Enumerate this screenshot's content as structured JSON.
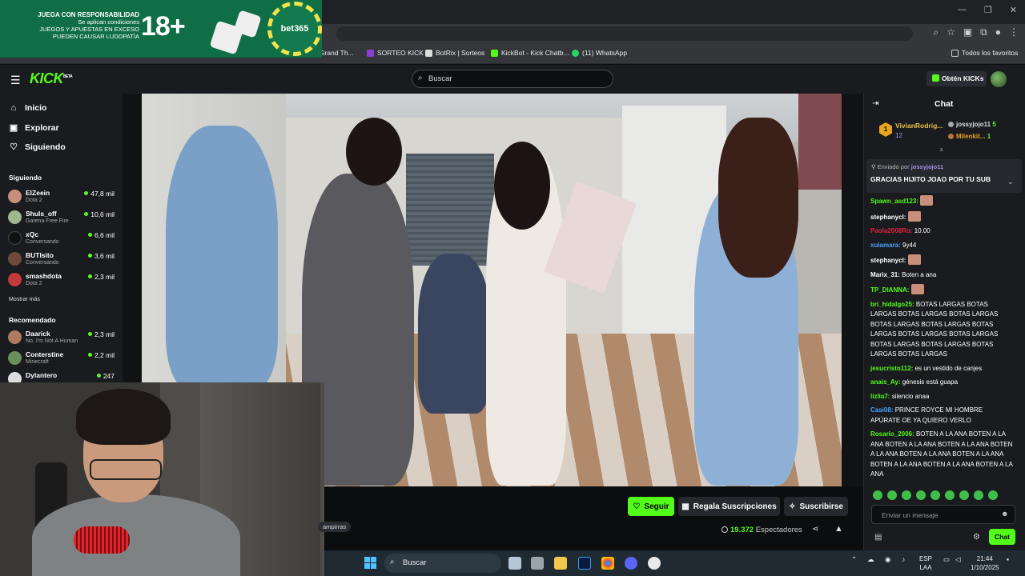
{
  "browser": {
    "bookmarks": [
      {
        "label": "le de Grand Th...",
        "color": "#888888"
      },
      {
        "label": "SORTEO KICK",
        "color": "#8b3fd6"
      },
      {
        "label": "BotRix | Sorteos",
        "color": "#dddddd"
      },
      {
        "label": "KickBot - Kick Chatb...",
        "color": "#53fc18"
      },
      {
        "label": "(11) WhatsApp",
        "color": "#25d366"
      }
    ],
    "all_favorites": "Todos los favoritos"
  },
  "ad": {
    "title": "JUEGA CON RESPONSABILIDAD",
    "line1": "Se aplican condiciones",
    "line2": "JUEGOS Y APUESTAS EN EXCESO",
    "line3": "PUEDEN CAUSAR LUDOPATÍA",
    "age": "18+",
    "brand": "bet365"
  },
  "header": {
    "logo": "KICK",
    "logo_tag": "BETA",
    "search_placeholder": "Buscar",
    "kicks_button": "Obtén KICKs"
  },
  "sidebar": {
    "nav": [
      {
        "label": "Inicio",
        "icon": "home-icon"
      },
      {
        "label": "Explorar",
        "icon": "compass-icon"
      },
      {
        "label": "Siguiendo",
        "icon": "heart-icon"
      }
    ],
    "following_title": "Siguiendo",
    "following": [
      {
        "name": "ElZeein",
        "category": "Dota 2",
        "viewers": "47,8 mil",
        "color": "#c98f7a"
      },
      {
        "name": "Shuls_off",
        "category": "Garena Free Fire",
        "viewers": "10,6 mil",
        "color": "#9fb78d"
      },
      {
        "name": "xQc",
        "category": "Conversando",
        "viewers": "6,6 mil",
        "color": "#111111"
      },
      {
        "name": "BUTIsito",
        "category": "Conversando",
        "viewers": "3,6 mil",
        "color": "#6d4a3a"
      },
      {
        "name": "smashdota",
        "category": "Dota 2",
        "viewers": "2,3 mil",
        "color": "#c43a3a"
      }
    ],
    "show_more": "Mostrar más",
    "recommended_title": "Recomendado",
    "recommended": [
      {
        "name": "Daarick",
        "category": "No, I'm Not A Human",
        "viewers": "2,3 mil",
        "color": "#b07a60"
      },
      {
        "name": "Conterstine",
        "category": "Minecraft",
        "viewers": "2,2 mil",
        "color": "#6a8f5a"
      },
      {
        "name": "Dylantero",
        "category": "",
        "viewers": "247",
        "color": "#dddddd"
      }
    ]
  },
  "stream": {
    "follow": "Seguir",
    "gift_subs": "Regala Suscripciones",
    "subscribe": "Suscribirse",
    "tag": "ampirras",
    "viewers_count": "19.372",
    "viewers_label": "Espectadores"
  },
  "chat": {
    "title": "Chat",
    "leaderboard": {
      "rank1_badge": "1",
      "rank1_name": "VivianRodrig...",
      "rank1_subs": "12",
      "rank2_name": "jossyjojo11",
      "rank2_subs": "5",
      "rank3_name": "Milenkit...",
      "rank3_subs": "1"
    },
    "pinned_by_label": "Enviado por",
    "pinned_by_user": "jossyjojo11",
    "pinned_message": "GRACIAS HIJITO JOAO POR TU SUB",
    "messages": [
      {
        "user": "Spawn_asd123:",
        "color": "#53fc18",
        "text": "",
        "emote": true
      },
      {
        "user": "stephanycl:",
        "color": "#ffffff",
        "text": "",
        "emote": true
      },
      {
        "user": "Paola2008Ro:",
        "color": "#e0243a",
        "text": "10.00",
        "emote": false
      },
      {
        "user": "xuiamara:",
        "color": "#4aa3ff",
        "text": "9y44",
        "emote": false
      },
      {
        "user": "stephanycl:",
        "color": "#ffffff",
        "text": "",
        "emote": true
      },
      {
        "user": "Marix_31:",
        "color": "#ffffff",
        "text": "Boten a ana",
        "emote": false
      },
      {
        "user": "TP_DIANNA:",
        "color": "#53fc18",
        "text": "",
        "emote": true
      },
      {
        "user": "bri_hidalgo25:",
        "color": "#53fc18",
        "text": "BOTAS LARGAS BOTAS LARGAS BOTAS LARGAS BOTAS LARGAS BOTAS LARGAS BOTAS LARGAS BOTAS LARGAS BOTAS LARGAS BOTAS LARGAS BOTAS LARGAS BOTAS LARGAS BOTAS LARGAS BOTAS LARGAS",
        "emote": false
      },
      {
        "user": "jesucristo112:",
        "color": "#53fc18",
        "text": "es un vestido de canjes",
        "emote": false
      },
      {
        "user": "anais_Ay:",
        "color": "#53fc18",
        "text": "génesis está guapa",
        "emote": false
      },
      {
        "user": "lizlia7:",
        "color": "#53fc18",
        "text": "silencio anaa",
        "emote": false
      },
      {
        "user": "Casi08:",
        "color": "#4aa3ff",
        "text": "PRINCE ROYCE MI HOMBRE APÚRATE OE YA QUIERO VERLO",
        "emote": false
      },
      {
        "user": "Rosario_2006:",
        "color": "#53fc18",
        "text": "BOTEN A LA ANA BOTEN A LA ANA BOTEN A LA ANA BOTEN A LA ANA BOTEN A LA ANA BOTEN A LA ANA BOTEN A LA ANA BOTEN A LA ANA BOTEN A LA ANA BOTEN A LA ANA",
        "emote": false
      }
    ],
    "input_placeholder": "Enviar un mensaje",
    "send_button": "Chat"
  },
  "taskbar": {
    "search": "Buscar",
    "lang": "ESP",
    "lang2": "LAA",
    "time": "21:44",
    "date": "1/10/2025"
  }
}
